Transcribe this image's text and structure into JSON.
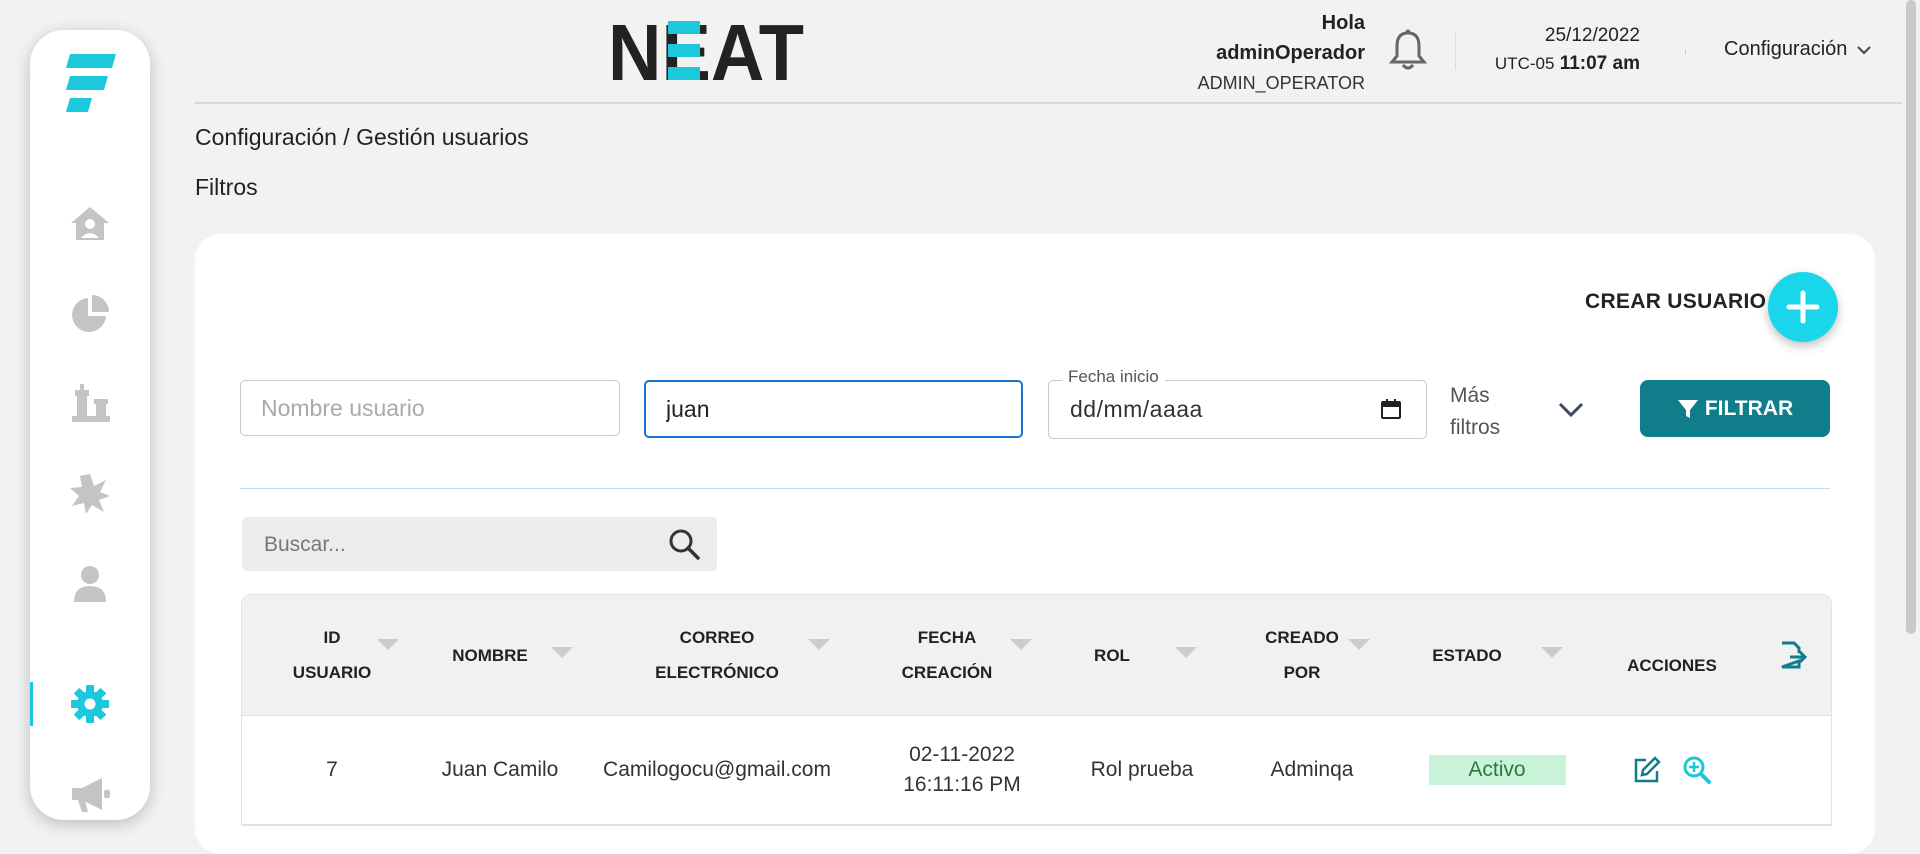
{
  "header": {
    "brand": "NEAT",
    "greeting": "Hola",
    "username": "adminOperador",
    "role": "ADMIN_OPERATOR",
    "date": "25/12/2022",
    "timezone": "UTC-05",
    "time": "11:07 am",
    "config_menu": "Configuración"
  },
  "sidebar": {
    "items": [
      {
        "name": "home",
        "icon": "home-user-icon"
      },
      {
        "name": "reports",
        "icon": "pie-chart-icon"
      },
      {
        "name": "strategy",
        "icon": "chess-icon"
      },
      {
        "name": "incidents",
        "icon": "burst-icon"
      },
      {
        "name": "users",
        "icon": "user-icon"
      },
      {
        "name": "settings",
        "icon": "gear-icon",
        "active": true
      },
      {
        "name": "campaigns",
        "icon": "megaphone-icon"
      }
    ],
    "accent": "#1ec8dc"
  },
  "page": {
    "breadcrumb": "Configuración / Gestión usuarios",
    "filters_title": "Filtros"
  },
  "filters": {
    "create_label": "CREAR USUARIO",
    "username_placeholder": "Nombre usuario",
    "name_value": "juan",
    "date_label": "Fecha inicio",
    "date_placeholder": "dd/mm/aaaa",
    "more_filters_line1": "Más",
    "more_filters_line2": "filtros",
    "filter_button": "FILTRAR",
    "filter_button_color": "#107d8b"
  },
  "search": {
    "placeholder": "Buscar..."
  },
  "table": {
    "columns": [
      {
        "line1": "ID",
        "line2": "USUARIO"
      },
      {
        "line1": "NOMBRE",
        "line2": ""
      },
      {
        "line1": "CORREO",
        "line2": "ELECTRÓNICO"
      },
      {
        "line1": "FECHA",
        "line2": "CREACIÓN"
      },
      {
        "line1": "ROL",
        "line2": ""
      },
      {
        "line1": "CREADO",
        "line2": "POR"
      },
      {
        "line1": "ESTADO",
        "line2": ""
      },
      {
        "line1": "ACCIONES",
        "line2": ""
      }
    ],
    "rows": [
      {
        "id": "7",
        "name": "Juan Camilo",
        "email": "Camilogocu@gmail.com",
        "date": "02-11-2022",
        "time": "16:11:16 PM",
        "role": "Rol prueba",
        "created_by": "Adminqa",
        "status": "Activo"
      }
    ],
    "status_color": "#c8f3d8",
    "icon_color": "#107d8b"
  }
}
